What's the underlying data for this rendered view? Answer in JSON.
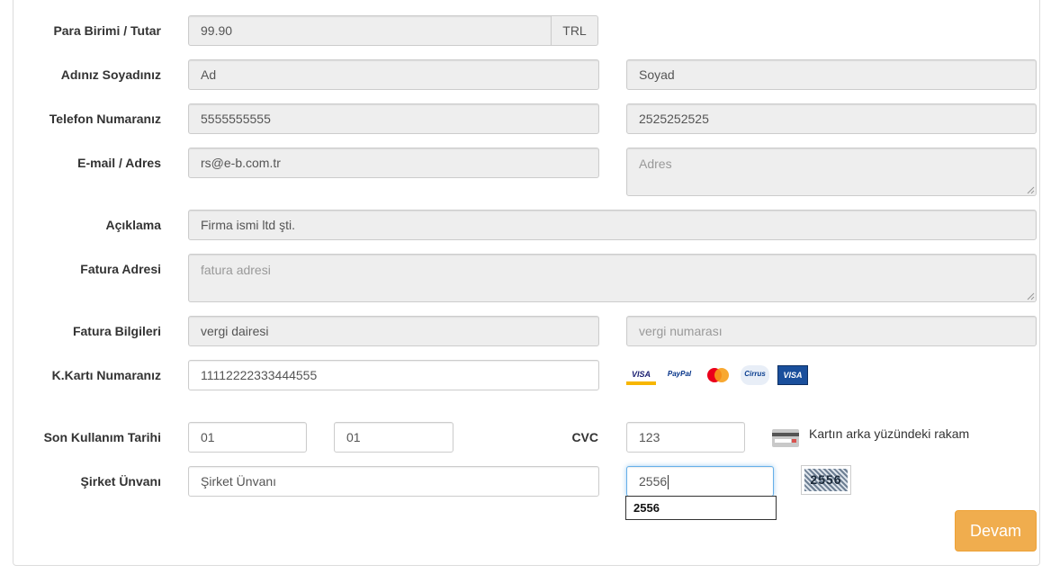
{
  "form": {
    "amount": {
      "label": "Para Birimi / Tutar",
      "value": "99.90",
      "currency": "TRL"
    },
    "name": {
      "label": "Adınız Soyadınız",
      "first": "Ad",
      "last": "Soyad"
    },
    "phone": {
      "label": "Telefon Numaranız",
      "phone1": "5555555555",
      "phone2": "2525252525"
    },
    "email": {
      "label": "E-mail / Adres",
      "email": "rs@e-b.com.tr",
      "address_placeholder": "Adres"
    },
    "description": {
      "label": "Açıklama",
      "value": "Firma ismi ltd şti."
    },
    "invoice_address": {
      "label": "Fatura Adresi",
      "placeholder": "fatura adresi"
    },
    "invoice_info": {
      "label": "Fatura Bilgileri",
      "tax_office": "vergi dairesi",
      "tax_number_placeholder": "vergi numarası"
    },
    "card_number": {
      "label": "K.Kartı Numaranız",
      "value": "11112222333444555"
    },
    "card_logos": [
      "VISA",
      "PayPal",
      "Mastercard",
      "Cirrus",
      "VISA"
    ],
    "expiry": {
      "label": "Son Kullanım Tarihi",
      "month": "01",
      "year": "01"
    },
    "cvc": {
      "label": "CVC",
      "value": "123",
      "note": "Kartın arka yüzündeki rakam"
    },
    "company": {
      "label": "Şirket Ünvanı",
      "value": "Şirket Ünvanı"
    },
    "captcha": {
      "value": "2556",
      "suggestion": "2556",
      "image_text": "2556"
    },
    "submit_label": "Devam"
  },
  "colors": {
    "accent": "#f0ad4e",
    "input_bg": "#eeeeee",
    "focus": "#66afe9"
  }
}
